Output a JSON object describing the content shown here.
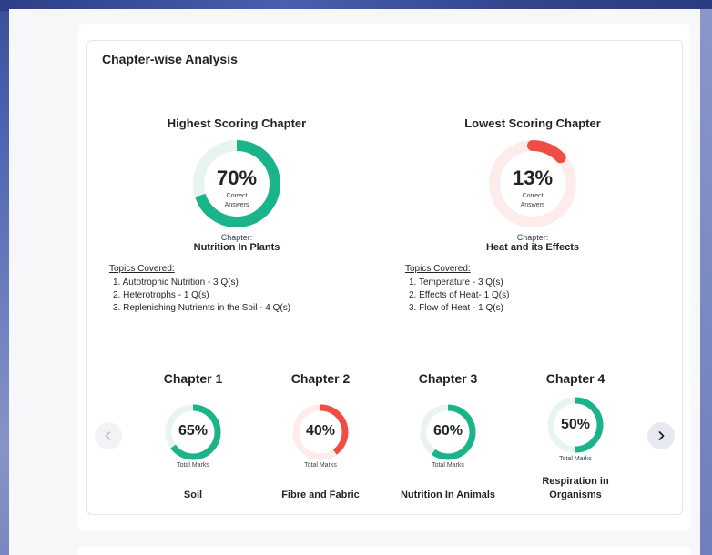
{
  "section_title": "Chapter-wise Analysis",
  "colors": {
    "green": "#1bb38a",
    "green_track": "#e7f4f0",
    "red": "#f04e45",
    "red_track": "#fdeceb"
  },
  "highest": {
    "heading": "Highest Scoring Chapter",
    "percent_value": 70,
    "percent_label": "70%",
    "sub_line1": "Correct",
    "sub_line2": "Answers",
    "chapter_caption": "Chapter:",
    "chapter_name": "Nutrition In Plants",
    "topics_heading": "Topics Covered:",
    "topics": [
      "1. Autotrophic Nutrition - 3 Q(s)",
      "2. Heterotrophs - 1 Q(s)",
      "3. Replenishing Nutrients in the Soil - 4 Q(s)"
    ]
  },
  "lowest": {
    "heading": "Lowest Scoring Chapter",
    "percent_value": 13,
    "percent_label": "13%",
    "sub_line1": "Correct",
    "sub_line2": "Answers",
    "chapter_caption": "Chapter:",
    "chapter_name": "Heat and its Effects",
    "topics_heading": "Topics Covered:",
    "topics": [
      "1. Temperature - 3 Q(s)",
      "2. Effects of Heat- 1 Q(s)",
      "3. Flow of Heat - 1 Q(s)"
    ]
  },
  "chapters": [
    {
      "title": "Chapter 1",
      "percent_value": 65,
      "percent_label": "65%",
      "sub": "Total Marks",
      "name": "Soil",
      "color": "green"
    },
    {
      "title": "Chapter 2",
      "percent_value": 40,
      "percent_label": "40%",
      "sub": "Total Marks",
      "name": "Fibre and Fabric",
      "color": "red"
    },
    {
      "title": "Chapter 3",
      "percent_value": 60,
      "percent_label": "60%",
      "sub": "Total Marks",
      "name": "Nutrition In Animals",
      "color": "green"
    },
    {
      "title": "Chapter 4",
      "percent_value": 50,
      "percent_label": "50%",
      "sub": "Total Marks",
      "name_line1": "Respiration in",
      "name_line2": "Organisms",
      "color": "green"
    }
  ],
  "carousel": {
    "prev_icon": "chevron-left-icon",
    "next_icon": "chevron-right-icon"
  }
}
